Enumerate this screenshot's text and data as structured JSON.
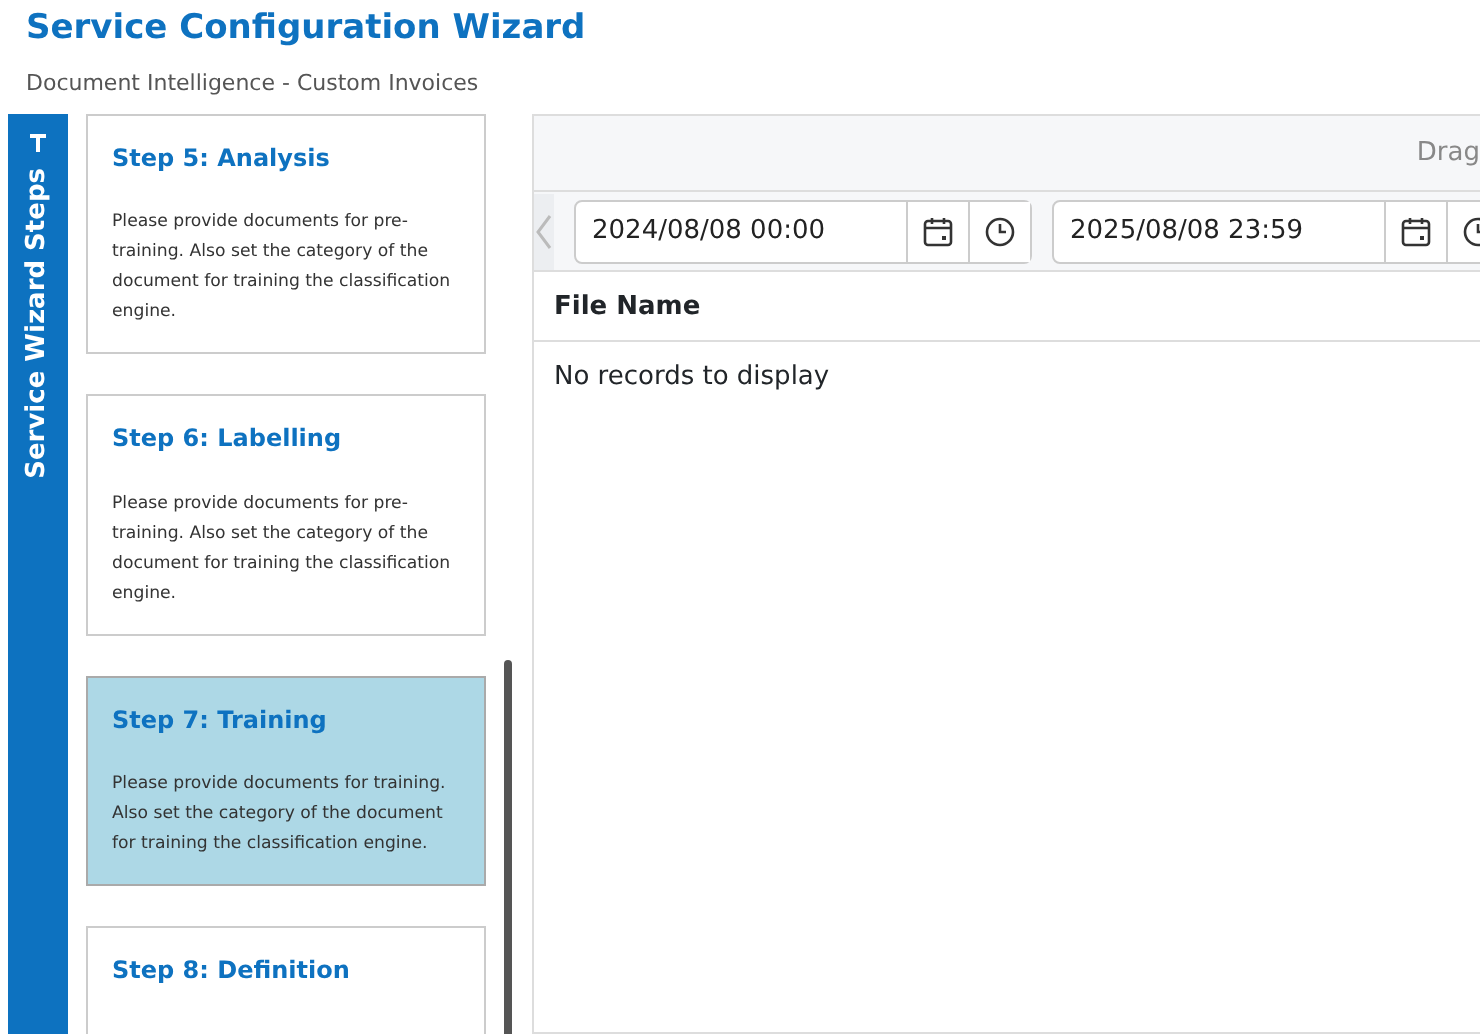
{
  "header": {
    "title": "Service Configuration Wizard",
    "subtitle": "Document Intelligence - Custom Invoices"
  },
  "sidebar": {
    "label": "Service Wizard Steps",
    "pinned": true
  },
  "steps": [
    {
      "title": "Step 5: Analysis",
      "description": "Please provide documents for pre-training. Also set the category of the document for training the classification engine.",
      "selected": false
    },
    {
      "title": "Step 6: Labelling",
      "description": "Please provide documents for pre-training. Also set the category of the document for training the classification engine.",
      "selected": false
    },
    {
      "title": "Step 7: Training",
      "description": "Please provide documents for training. Also set the category of the document for training the classification engine.",
      "selected": true
    },
    {
      "title": "Step 8: Definition",
      "selected": false
    }
  ],
  "grid": {
    "group_hint": "Drag",
    "from": "2024/08/08 00:00",
    "to": "2025/08/08 23:59",
    "columns": [
      "File Name"
    ],
    "empty_text": "No records to display"
  }
}
